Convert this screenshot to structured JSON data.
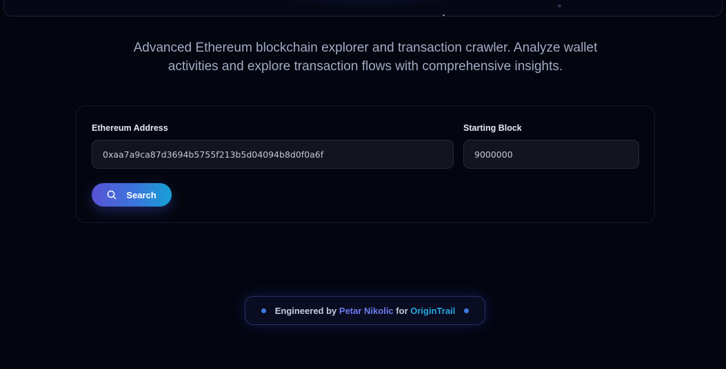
{
  "description": "Advanced Ethereum blockchain explorer and transaction crawler. Analyze wallet activities and explore transaction flows with comprehensive insights.",
  "form": {
    "address_label": "Ethereum Address",
    "address_value": "0xaa7a9ca87d3694b5755f213b5d04094b8d0f0a6f",
    "block_label": "Starting Block",
    "block_value": "9000000",
    "search_label": "Search",
    "search_icon": "search-icon"
  },
  "footer": {
    "prefix": "Engineered by",
    "author": "Petar Nikolic",
    "joiner": "for",
    "company": "OriginTrail"
  },
  "colors": {
    "background": "#03050f",
    "button_gradient_start": "#5853d6",
    "button_gradient_end": "#17a0d4",
    "author_color": "#6c7bf0",
    "company_color": "#28a6e0"
  }
}
